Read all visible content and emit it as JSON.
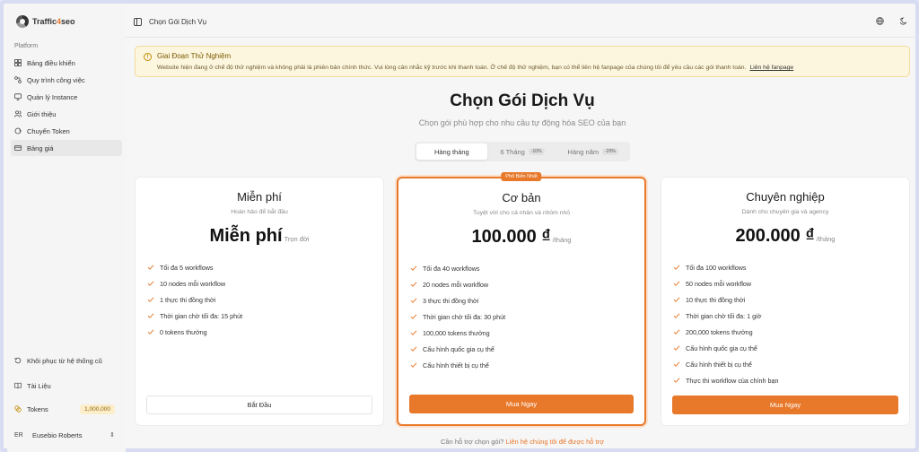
{
  "brand": {
    "name_part1": "Traffic",
    "name_part2": "4",
    "name_part3": "seo"
  },
  "sidebar": {
    "section_label": "Platform",
    "items": [
      {
        "label": "Bảng điều khiển",
        "icon": "grid-icon"
      },
      {
        "label": "Quy trình công việc",
        "icon": "workflow-icon"
      },
      {
        "label": "Quản lý Instance",
        "icon": "monitor-icon"
      },
      {
        "label": "Giới thiệu",
        "icon": "users-icon"
      },
      {
        "label": "Chuyển Token",
        "icon": "transfer-icon"
      },
      {
        "label": "Bảng giá",
        "icon": "credit-card-icon"
      }
    ],
    "restore_label": "Khôi phục từ hệ thống cũ",
    "docs_label": "Tài Liệu",
    "tokens_label": "Tokens",
    "tokens_value": "1,000,000",
    "user_initials": "ER",
    "user_name": "Eusebio Roberts"
  },
  "topbar": {
    "page_title": "Chọn Gói Dịch Vụ"
  },
  "alert": {
    "title": "Giai Đoạn Thử Nghiệm",
    "text": "Website hiện đang ở chế độ thử nghiệm và không phải là phiên bản chính thức. Vui lòng cân nhắc kỹ trước khi thanh toán. Ở chế độ thử nghiệm, bạn có thể liên hệ fanpage của chúng tôi để yêu cầu các gói thanh toán.",
    "link": "Liên hệ fanpage"
  },
  "main": {
    "title": "Chọn Gói Dịch Vụ",
    "subtitle": "Chọn gói phù hợp cho nhu cầu tự động hóa SEO của bạn"
  },
  "tabs": [
    {
      "label": "Hàng tháng",
      "badge": ""
    },
    {
      "label": "6 Tháng",
      "badge": "-10%"
    },
    {
      "label": "Hàng năm",
      "badge": "-20%"
    }
  ],
  "plans": [
    {
      "name": "Miễn phí",
      "desc": "Hoàn hảo để bắt đầu",
      "price": "Miễn phí",
      "unit": "Trọn đời",
      "features": [
        "Tối đa 5 workflows",
        "10 nodes mỗi workflow",
        "1 thực thi đồng thời",
        "Thời gian chờ tối đa: 15 phút",
        "0 tokens thưởng"
      ],
      "button": "Bắt Đầu"
    },
    {
      "badge": "Phổ Biến Nhất",
      "name": "Cơ bản",
      "desc": "Tuyệt vời cho cá nhân và nhóm nhỏ",
      "price": "100.000 ₫",
      "unit": "/tháng",
      "features": [
        "Tối đa 40 workflows",
        "20 nodes mỗi workflow",
        "3 thực thi đồng thời",
        "Thời gian chờ tối đa: 30 phút",
        "100,000 tokens thưởng",
        "Cấu hình quốc gia cụ thể",
        "Cấu hình thiết bị cụ thể"
      ],
      "button": "Mua Ngay"
    },
    {
      "name": "Chuyên nghiệp",
      "desc": "Dành cho chuyên gia và agency",
      "price": "200.000 ₫",
      "unit": "/tháng",
      "features": [
        "Tối đa 100 workflows",
        "50 nodes mỗi workflow",
        "10 thực thi đồng thời",
        "Thời gian chờ tối đa: 1 giờ",
        "200,000 tokens thưởng",
        "Cấu hình quốc gia cụ thể",
        "Cấu hình thiết bị cụ thể",
        "Thực thi workflow của chính bạn"
      ],
      "button": "Mua Ngay"
    }
  ],
  "footer": {
    "text": "Cần hỗ trợ chọn gói?",
    "link": "Liên hệ chúng tôi để được hỗ trợ"
  },
  "colors": {
    "accent": "#e8782a",
    "alert_bg": "#fdf6df"
  }
}
